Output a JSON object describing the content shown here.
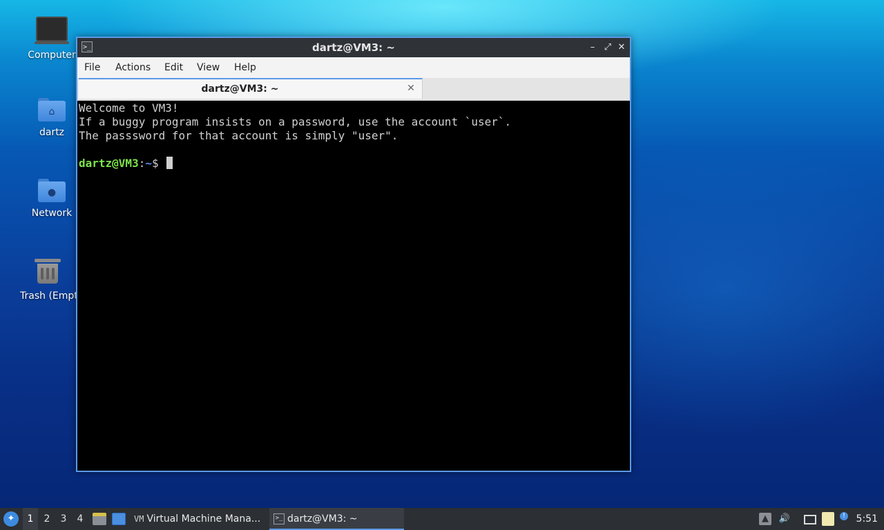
{
  "desktop": {
    "icons": [
      {
        "label": "Computer"
      },
      {
        "label": "dartz"
      },
      {
        "label": "Network"
      },
      {
        "label": "Trash (Empty)"
      }
    ]
  },
  "window": {
    "title": "dartz@VM3: ~",
    "menu": [
      "File",
      "Actions",
      "Edit",
      "View",
      "Help"
    ],
    "tab": {
      "label": "dartz@VM3: ~"
    },
    "terminal": {
      "lines": [
        "Welcome to VM3!",
        "If a buggy program insists on a password, use the account `user`.",
        "The passsword for that account is simply \"user\"."
      ],
      "prompt": {
        "user": "dartz@VM3",
        "sep": ":",
        "path": "~",
        "symbol": "$ "
      }
    }
  },
  "taskbar": {
    "desktops": [
      "1",
      "2",
      "3",
      "4"
    ],
    "active_desktop": "1",
    "tasks": [
      {
        "label": "Virtual Machine Mana..."
      },
      {
        "label": "dartz@VM3: ~"
      }
    ],
    "clock": "5:51"
  },
  "colors": {
    "accent": "#5a9ae8",
    "prompt_user": "#7ce24a",
    "prompt_path": "#5c8cf0"
  }
}
